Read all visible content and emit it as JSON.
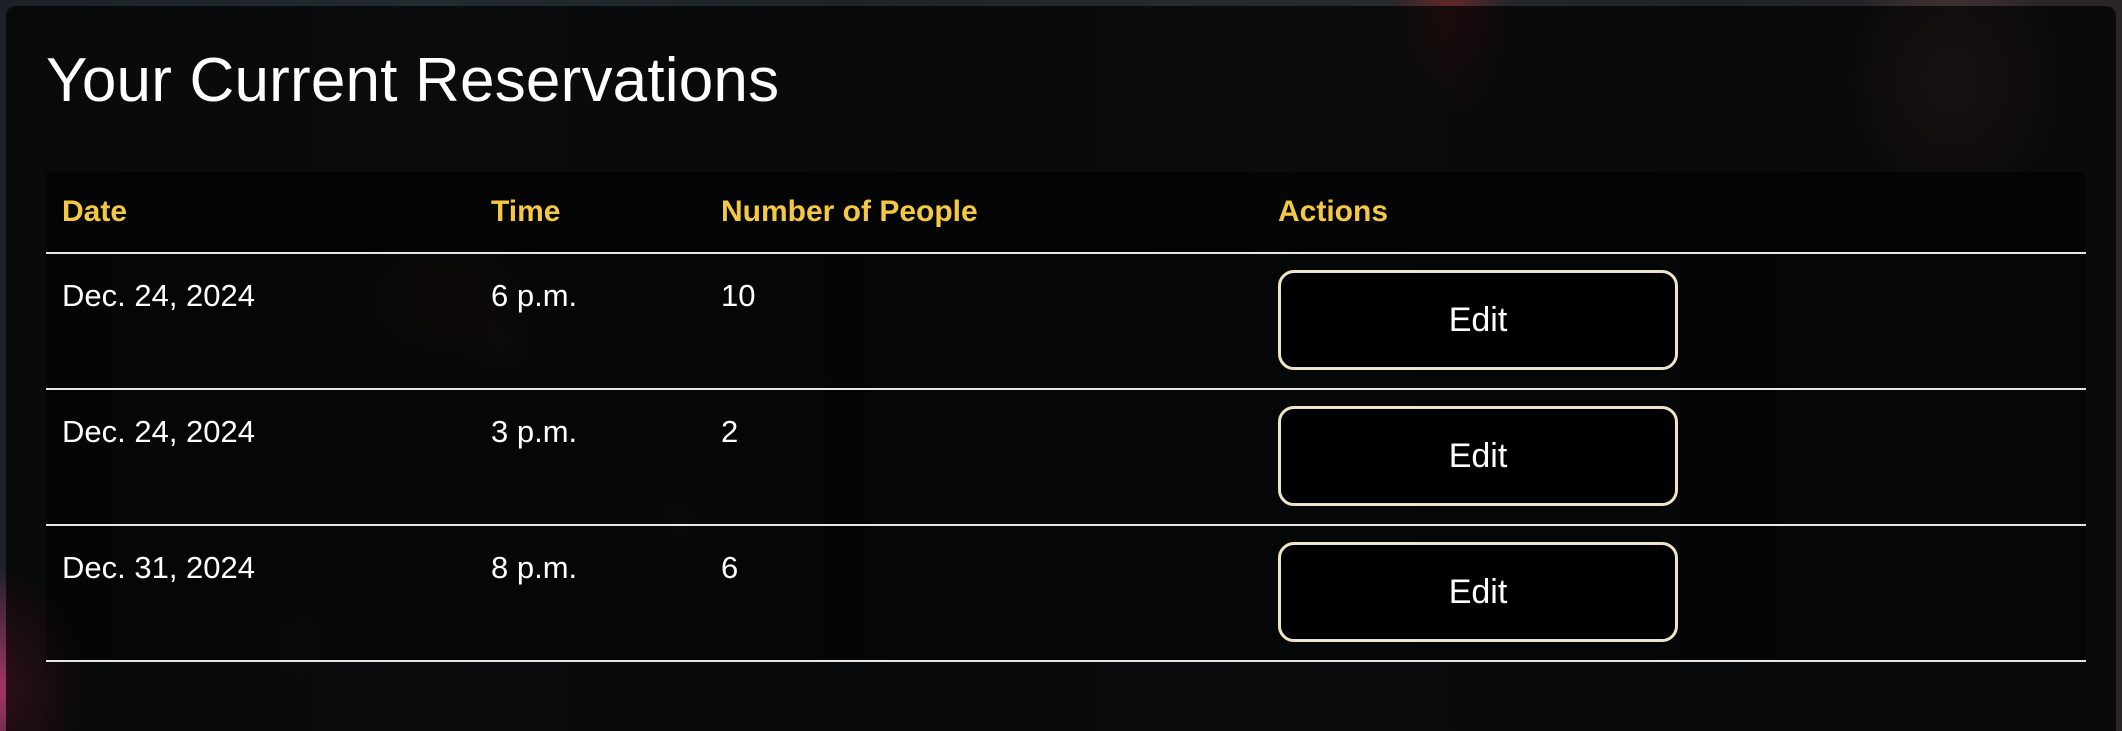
{
  "page": {
    "title": "Your Current Reservations"
  },
  "colors": {
    "header_text": "#f5c842",
    "button_border": "#efe3cc",
    "text": "#ffffff"
  },
  "table": {
    "headers": {
      "date": "Date",
      "time": "Time",
      "people": "Number of People",
      "actions": "Actions"
    },
    "rows": [
      {
        "date": "Dec. 24, 2024",
        "time": "6 p.m.",
        "people": "10",
        "action_label": "Edit"
      },
      {
        "date": "Dec. 24, 2024",
        "time": "3 p.m.",
        "people": "2",
        "action_label": "Edit"
      },
      {
        "date": "Dec. 31, 2024",
        "time": "8 p.m.",
        "people": "6",
        "action_label": "Edit"
      }
    ]
  }
}
